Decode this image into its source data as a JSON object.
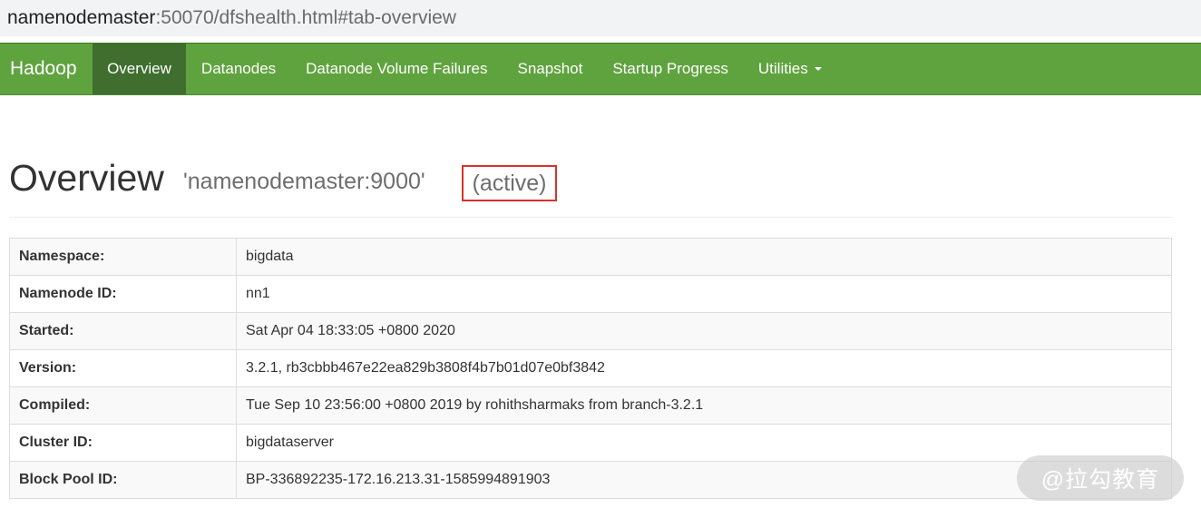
{
  "browser": {
    "url_host": "namenodemaster",
    "url_rest": ":50070/dfshealth.html#tab-overview"
  },
  "navbar": {
    "brand": "Hadoop",
    "items": [
      {
        "label": "Overview",
        "active": true
      },
      {
        "label": "Datanodes",
        "active": false
      },
      {
        "label": "Datanode Volume Failures",
        "active": false
      },
      {
        "label": "Snapshot",
        "active": false
      },
      {
        "label": "Startup Progress",
        "active": false
      },
      {
        "label": "Utilities",
        "active": false,
        "dropdown": true
      }
    ],
    "color": "#5fa33e",
    "active_color": "#3f6e2f"
  },
  "page": {
    "title": "Overview",
    "subtitle": "'namenodemaster:9000'",
    "state": "(active)",
    "highlight_color": "#d9312b"
  },
  "overview": {
    "rows": [
      {
        "key": "Namespace:",
        "value": "bigdata"
      },
      {
        "key": "Namenode ID:",
        "value": "nn1"
      },
      {
        "key": "Started:",
        "value": "Sat Apr 04 18:33:05 +0800 2020"
      },
      {
        "key": "Version:",
        "value": "3.2.1, rb3cbbb467e22ea829b3808f4b7b01d07e0bf3842"
      },
      {
        "key": "Compiled:",
        "value": "Tue Sep 10 23:56:00 +0800 2019 by rohithsharmaks from branch-3.2.1"
      },
      {
        "key": "Cluster ID:",
        "value": "bigdataserver"
      },
      {
        "key": "Block Pool ID:",
        "value": "BP-336892235-172.16.213.31-1585994891903"
      }
    ]
  },
  "watermark": {
    "text": "@拉勾教育"
  }
}
